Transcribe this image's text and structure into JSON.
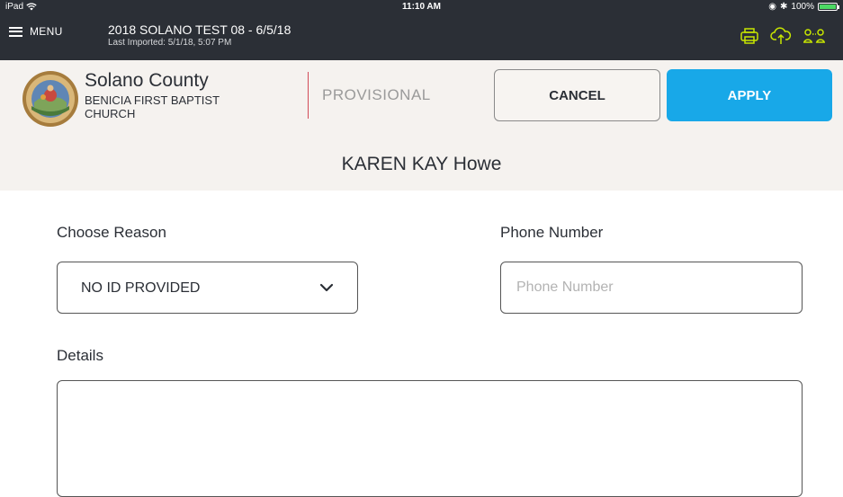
{
  "status_bar": {
    "device": "iPad",
    "time": "11:10 AM",
    "battery": "100%",
    "battery_level": 1.0
  },
  "top_bar": {
    "menu_label": "MENU",
    "election_title": "2018 SOLANO TEST 08 - 6/5/18",
    "last_imported": "Last Imported: 5/1/18, 5:07 PM",
    "icons": [
      "printer-icon",
      "cloud-upload-icon",
      "users-sync-icon"
    ],
    "icon_color": "#c8e600"
  },
  "header": {
    "county": "Solano County",
    "precinct": "BENICIA FIRST BAPTIST CHURCH",
    "mode": "PROVISIONAL",
    "cancel_label": "CANCEL",
    "apply_label": "APPLY",
    "accent_color": "#18a8e8"
  },
  "voter": {
    "name": "KAREN KAY Howe"
  },
  "form": {
    "reason_label": "Choose Reason",
    "reason_value": "NO ID PROVIDED",
    "phone_label": "Phone Number",
    "phone_value": "",
    "phone_placeholder": "Phone Number",
    "details_label": "Details",
    "details_value": ""
  }
}
